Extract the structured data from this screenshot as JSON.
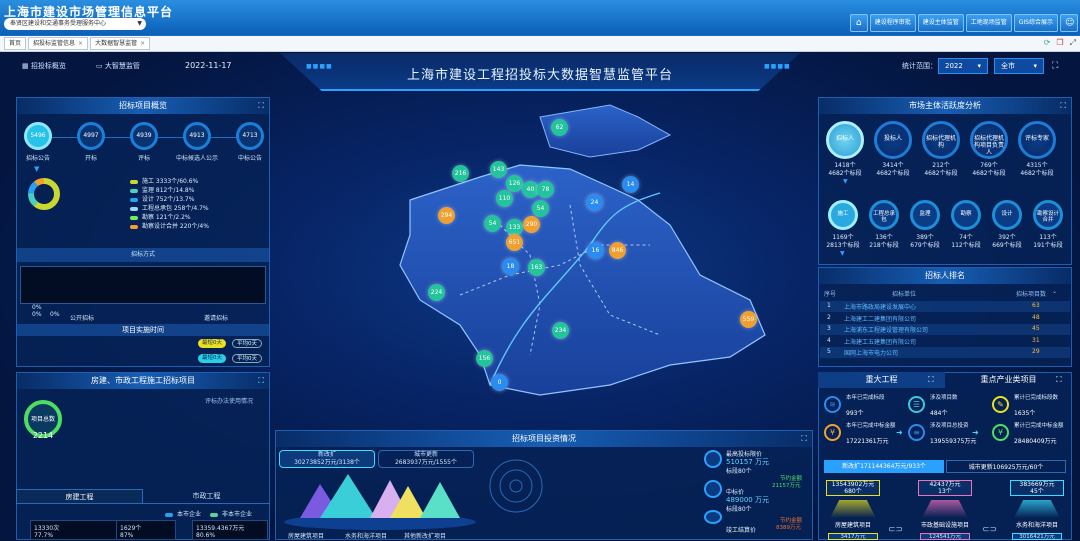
{
  "app": {
    "title": "上海市建设市场管理信息平台",
    "org": "奉贤区建设和交通事务受理服务中心"
  },
  "topnav": [
    "建设程序审批",
    "建设主体监管",
    "工地现场监管",
    "GIS综合展示"
  ],
  "browser_tabs": [
    "首页",
    "招投标监管信息",
    "大数据智慧监管"
  ],
  "header": {
    "left_links": [
      "招投标概览",
      "大智慧监管"
    ],
    "date": "2022-11-17",
    "title": "上海市建设工程招投标大数据智慧监管平台",
    "stat_label": "统计范围：",
    "year": "2022",
    "scope": "全市"
  },
  "overview": {
    "title": "招标项目概览",
    "stages": [
      {
        "value": "5496",
        "label": "招标公告"
      },
      {
        "value": "4997",
        "label": "开标"
      },
      {
        "value": "4939",
        "label": "评标"
      },
      {
        "value": "4913",
        "label": "中标候选人公示"
      },
      {
        "value": "4713",
        "label": "中标公告"
      }
    ],
    "legend": [
      {
        "text": "施工  3333个/60.6%",
        "color": "#c8d830"
      },
      {
        "text": "监理  812个/14.8%",
        "color": "#4ad0c0"
      },
      {
        "text": "设计  752个/13.7%",
        "color": "#2aa0f0"
      },
      {
        "text": "工程总承包  258个/4.7%",
        "color": "#9ad6ff"
      },
      {
        "text": "勘察  121个/2.2%",
        "color": "#6af060"
      },
      {
        "text": "勘察设计合并  220个/4%",
        "color": "#f0a030"
      }
    ],
    "method_title": "招标方式",
    "method_ticks": [
      "0%",
      "0%",
      "0%"
    ],
    "method_labels": [
      "公开招标",
      "邀请招标"
    ],
    "duration_title": "项目实施时间",
    "duration_pills": [
      [
        "最短0天",
        "平均0天"
      ],
      [
        "最短0天",
        "平均0天"
      ]
    ]
  },
  "housing": {
    "title": "房建、市政工程施工招标项目",
    "subtitle": "评标办法使用情况",
    "total_label": "项目总数",
    "total": "2214",
    "tabs": [
      "房建工程",
      "市政工程"
    ],
    "legend": [
      "本市企业",
      "非本市企业"
    ],
    "cards": [
      "13330次",
      "1629个",
      "13359.4367万元"
    ],
    "card_subs": [
      "77.7%",
      "87%",
      "80.6%"
    ]
  },
  "map": {
    "bubbles": [
      {
        "v": "62",
        "c": "teal"
      },
      {
        "v": "216",
        "c": "teal"
      },
      {
        "v": "143",
        "c": "teal"
      },
      {
        "v": "126",
        "c": "teal"
      },
      {
        "v": "40",
        "c": "teal"
      },
      {
        "v": "78",
        "c": "teal"
      },
      {
        "v": "14",
        "c": "blue"
      },
      {
        "v": "110",
        "c": "teal"
      },
      {
        "v": "54",
        "c": "teal"
      },
      {
        "v": "294",
        "c": "orange"
      },
      {
        "v": "24",
        "c": "blue"
      },
      {
        "v": "54",
        "c": "teal"
      },
      {
        "v": "133",
        "c": "teal"
      },
      {
        "v": "290",
        "c": "orange"
      },
      {
        "v": "651",
        "c": "orange"
      },
      {
        "v": "16",
        "c": "blue"
      },
      {
        "v": "846",
        "c": "orange"
      },
      {
        "v": "18",
        "c": "blue"
      },
      {
        "v": "163",
        "c": "teal"
      },
      {
        "v": "224",
        "c": "teal"
      },
      {
        "v": "559",
        "c": "orange"
      },
      {
        "v": "234",
        "c": "teal"
      },
      {
        "v": "156",
        "c": "teal"
      },
      {
        "v": "0",
        "c": "blue"
      }
    ]
  },
  "investment": {
    "title": "招标项目投资情况",
    "tab1": {
      "label": "新改扩",
      "value": "30273852万元/3138个"
    },
    "tab2": {
      "label": "城市更新",
      "value": "2683937万元/1555个"
    },
    "pyramid_labels": [
      "房屋建筑项目",
      "水务和海洋项目",
      "其他新改扩项目"
    ],
    "stats": [
      {
        "label": "最高投标限价",
        "value": "510157 万元",
        "sub": "标段80个"
      },
      {
        "label": "中标价",
        "value": "489000 万元",
        "sub": "标段80个"
      },
      {
        "label": "竣工结算价",
        "value": "",
        "sub": ""
      }
    ],
    "side_labels": [
      "节约金额",
      "21157万元",
      "节约金额",
      "8389万元"
    ]
  },
  "market": {
    "title": "市场主体活跃度分析",
    "row1": [
      {
        "name": "招标人",
        "count": "1418个",
        "sect": "4682个标段"
      },
      {
        "name": "投标人",
        "count": "3414个",
        "sect": "4682个标段"
      },
      {
        "name": "招标代理机构",
        "count": "212个",
        "sect": "4682个标段"
      },
      {
        "name": "招标代理机构项目负责人",
        "count": "769个",
        "sect": "4682个标段"
      },
      {
        "name": "评标专家",
        "count": "4315个",
        "sect": "4682个标段"
      }
    ],
    "row2": [
      {
        "name": "施工",
        "count": "1169个",
        "sect": "2813个标段"
      },
      {
        "name": "工程总承包",
        "count": "136个",
        "sect": "218个标段"
      },
      {
        "name": "监理",
        "count": "389个",
        "sect": "679个标段"
      },
      {
        "name": "勘察",
        "count": "74个",
        "sect": "112个标段"
      },
      {
        "name": "设计",
        "count": "392个",
        "sect": "669个标段"
      },
      {
        "name": "勘察设计合并",
        "count": "113个",
        "sect": "191个标段"
      }
    ]
  },
  "ranking": {
    "title": "招标人排名",
    "headers": [
      "序号",
      "招标单位",
      "招标项目数"
    ],
    "rows": [
      [
        "1",
        "上海市路政局建设发展中心",
        "63"
      ],
      [
        "2",
        "上海建工二建集团有限公司",
        "48"
      ],
      [
        "3",
        "上海浦东工程建设管理有限公司",
        "45"
      ],
      [
        "4",
        "上海建工五建集团有限公司",
        "31"
      ],
      [
        "5",
        "国网上海市电力公司",
        "29"
      ]
    ]
  },
  "major": {
    "tabs": [
      "重大工程",
      "重点产业类项目"
    ],
    "items": [
      {
        "t": "本年已完成标段",
        "v": "993个"
      },
      {
        "t": "涉及项目数",
        "v": "484个"
      },
      {
        "t": "累计已完成标段数",
        "v": "1635个"
      },
      {
        "t": "本年已完成中标金额",
        "v": "17221361万元"
      },
      {
        "t": "涉及项目总投资",
        "v": "139559375万元"
      },
      {
        "t": "累计已完成中标金额",
        "v": "28480409万元"
      }
    ],
    "subtabs": [
      "新改扩171144364万元/933个",
      "城市更新106925万元/60个"
    ],
    "cards": [
      {
        "v": "13543902万元",
        "s": "680个",
        "l": "房屋建筑项目"
      },
      {
        "v": "42437万元",
        "s": "13个",
        "l": "市政基础设施项目"
      },
      {
        "v": "383669万元",
        "s": "45个",
        "l": "水务和海洋项目"
      }
    ],
    "card_bottom": [
      "3417万元",
      "124541万元",
      "3016421万元"
    ]
  }
}
